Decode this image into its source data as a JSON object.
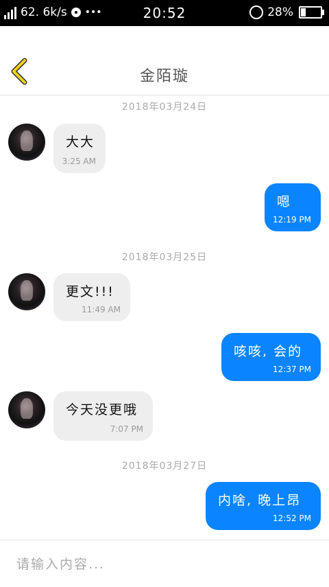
{
  "status_bar": {
    "network_type": "4G",
    "speed": "62. 6k/s",
    "extra_icons": [
      "disc-icon",
      "dots"
    ],
    "time": "20:52",
    "battery_percent": "28%",
    "battery_level": 0.28
  },
  "header": {
    "title": "金陌璇",
    "back_icon": "chevron-left-icon"
  },
  "messages": [
    {
      "type": "date",
      "text": "2018年03月24日"
    },
    {
      "type": "incoming",
      "text": "大大",
      "time": "3:25 AM"
    },
    {
      "type": "outgoing",
      "text": "嗯",
      "time": "12:19 PM"
    },
    {
      "type": "date",
      "text": "2018年03月25日"
    },
    {
      "type": "incoming",
      "text": "更文!!!",
      "time": "11:49 AM"
    },
    {
      "type": "outgoing",
      "text": "咳咳, 会的",
      "time": "12:37 PM"
    },
    {
      "type": "incoming",
      "text": "今天没更哦",
      "time": "7:07 PM"
    },
    {
      "type": "date",
      "text": "2018年03月27日"
    },
    {
      "type": "outgoing",
      "text": "内啥, 晚上昂",
      "time": "12:52 PM"
    }
  ],
  "input": {
    "placeholder": "请输入内容...",
    "value": ""
  },
  "colors": {
    "outgoing_bubble": "#0a84ff",
    "incoming_bubble": "#eeeeee",
    "back_icon": "#f2d21b"
  }
}
